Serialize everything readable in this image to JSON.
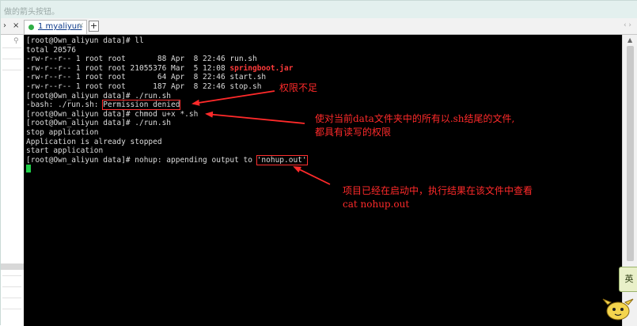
{
  "hint": "做的箭头按钮。",
  "tabbar": {
    "left_controls": [
      "›",
      "×"
    ],
    "tab": {
      "label": "1 myaliyun",
      "close": "×"
    },
    "new_tab": "+",
    "arrows": "‹ ›"
  },
  "terminal": {
    "lines": [
      "[root@Own_aliyun data]# ll",
      "total 20576",
      "-rw-r--r-- 1 root root       88 Apr  8 22:46 run.sh",
      "-rw-r--r-- 1 root root 21055376 Mar  5 12:08 ",
      "-rw-r--r-- 1 root root       64 Apr  8 22:46 start.sh",
      "-rw-r--r-- 1 root root      187 Apr  8 22:46 stop.sh",
      "[root@Own_aliyun data]# ./run.sh",
      "-bash: ./run.sh: ",
      "[root@Own_aliyun data]# chmod u+x *.sh",
      "[root@Own_aliyun data]# ./run.sh",
      "stop application",
      "Application is already stopped",
      "start application",
      "[root@Own_aliyun data]# nohup: appending output to "
    ],
    "jar_file": "springboot.jar",
    "permission_denied": "Permission denied",
    "nohup_file": "'nohup.out'"
  },
  "annotations": {
    "a1": "权限不足",
    "a2_line1": "使对当前data文件夹中的所有以.sh结尾的文件,",
    "a2_line2": "都具有读写的权限",
    "a3_line1": "项目已经在启动中，执行结果在该文件中查看",
    "a3_line2": "cat nohup.out"
  },
  "ime": {
    "label": "英"
  },
  "colors": {
    "annotation": "#ff2a2a",
    "cursor": "#21d04a",
    "tab_dot": "#2fae45"
  }
}
